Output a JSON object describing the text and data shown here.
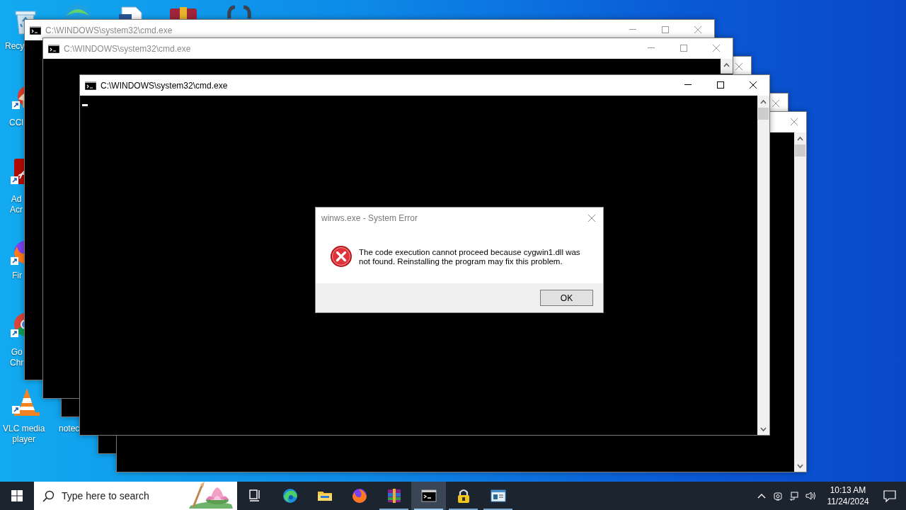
{
  "desktop_icons": [
    {
      "kind": "bin",
      "label_lines": [
        "Recy"
      ]
    },
    {
      "kind": "brush",
      "label_lines": [
        "CCl"
      ]
    },
    {
      "kind": "reader",
      "label_lines": [
        "Ad",
        "Acr"
      ]
    },
    {
      "kind": "foxbrowser",
      "label_lines": [
        "Fir"
      ]
    },
    {
      "kind": "ballbrowser",
      "label_lines": [
        "Go",
        "Chr"
      ]
    },
    {
      "kind": "cone",
      "label_lines": [
        "VLC media",
        "player"
      ]
    },
    {
      "label_lines": [
        "notec"
      ]
    }
  ],
  "windows": [
    {
      "title": "C:\\WINDOWS\\system32\\cmd.exe",
      "controls": [
        {
          "kind": "minimize"
        },
        {
          "kind": "maximize"
        },
        {
          "kind": "close"
        }
      ],
      "focused": false
    },
    {
      "title": "C:\\WINDOWS\\system32\\cmd.exe",
      "controls": [
        {
          "kind": "minimize"
        },
        {
          "kind": "maximize"
        },
        {
          "kind": "close"
        }
      ],
      "focused": false
    },
    {
      "controls": [
        {
          "kind": "close"
        }
      ],
      "focused": false
    },
    {
      "title": "C:\\WINDOWS\\system32\\cmd.exe",
      "controls": [
        {
          "kind": "minimize"
        },
        {
          "kind": "maximize"
        },
        {
          "kind": "close"
        }
      ],
      "focused": true,
      "cursor": true
    },
    {
      "controls": [
        {
          "kind": "close"
        }
      ],
      "focused": false
    },
    {
      "controls": [
        {
          "kind": "close"
        }
      ],
      "focused": false
    }
  ],
  "dialog": {
    "title": "winws.exe - System Error",
    "message": "The code execution cannot proceed because cygwin1.dll was not found. Reinstalling the program may fix this problem.",
    "button": "OK"
  },
  "taskbar": {
    "search": {
      "placeholder": "Type here to search"
    },
    "apps": [
      {
        "kind": "taskview",
        "running": false,
        "active": false
      },
      {
        "kind": "wavebrowser",
        "running": false,
        "active": false
      },
      {
        "kind": "folder",
        "running": false,
        "active": false
      },
      {
        "kind": "foxbrowser",
        "running": false,
        "active": false
      },
      {
        "kind": "archive",
        "running": true,
        "active": false
      },
      {
        "kind": "terminal",
        "running": true,
        "active": true
      },
      {
        "kind": "padlock",
        "running": true,
        "active": false
      },
      {
        "kind": "panel",
        "running": true,
        "active": false
      }
    ],
    "time": "10:13 AM",
    "date": "11/24/2024"
  }
}
